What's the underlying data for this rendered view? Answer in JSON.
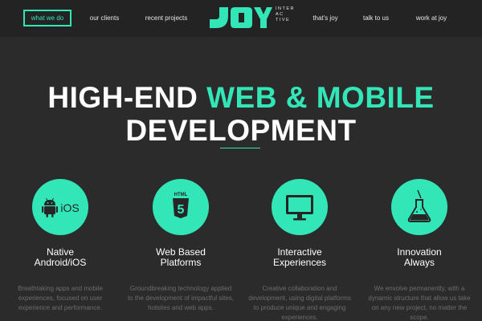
{
  "nav": {
    "items": [
      {
        "label": "what we do",
        "active": true
      },
      {
        "label": "our clients"
      },
      {
        "label": "recent projects"
      },
      {
        "label": "that's joy"
      },
      {
        "label": "talk to us"
      },
      {
        "label": "work at joy"
      }
    ]
  },
  "logo": {
    "wordmark": "JOY",
    "tagline_lines": [
      "INTER",
      "AC",
      "TIVE"
    ]
  },
  "hero": {
    "line1_white": "HIGH-END ",
    "line1_accent": "WEB & MOBILE",
    "line2": "DEVELOPMENT"
  },
  "features": [
    {
      "icon": "android-ios-icon",
      "icon_text": "iOS",
      "title_lines": [
        "Native",
        "Android/iOS"
      ],
      "description": "Breathtaking apps and mobile experiences, focused on user experience and performance."
    },
    {
      "icon": "html5-icon",
      "icon_text": "HTML",
      "icon_number": "5",
      "title_lines": [
        "Web Based",
        "Platforms"
      ],
      "description": "Groundbreaking technology applied to the development of impactful sites, hotsites and web apps."
    },
    {
      "icon": "monitor-icon",
      "title_lines": [
        "Interactive",
        "Experiences"
      ],
      "description": "Creative collaboration and development, using digital platforms to produce unique and engaging experiences."
    },
    {
      "icon": "flask-icon",
      "title_lines": [
        "Innovation",
        "Always"
      ],
      "description": "We envolve permanently, with a dynamic structure that allow us take on any new project, no matter the scope."
    }
  ],
  "colors": {
    "accent": "#33e6b8",
    "background": "#2b2b2b",
    "nav_background": "#232323",
    "muted_text": "#6c6c6c"
  }
}
